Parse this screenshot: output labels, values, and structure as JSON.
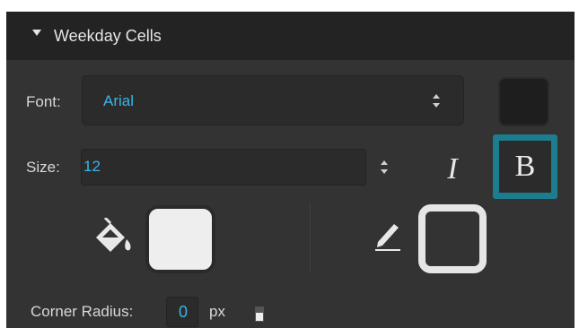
{
  "section": {
    "title": "Weekday Cells"
  },
  "font": {
    "label": "Font:",
    "value": "Arial",
    "color_swatch": "#1e1e1e"
  },
  "size": {
    "label": "Size:",
    "value": "12"
  },
  "style": {
    "italic_label": "I",
    "bold_label": "B",
    "bold_active": true
  },
  "fill": {
    "icon": "paint-bucket-icon",
    "color": "#eeeeee"
  },
  "stroke": {
    "icon": "pencil-icon",
    "color": "#e6e6e6"
  },
  "corner_radius": {
    "label": "Corner Radius:",
    "value": "0",
    "unit": "px"
  },
  "colors": {
    "accent": "#39b6e6",
    "active_border": "#1c7d8e",
    "panel_bg": "#333333",
    "header_bg": "#232323"
  }
}
